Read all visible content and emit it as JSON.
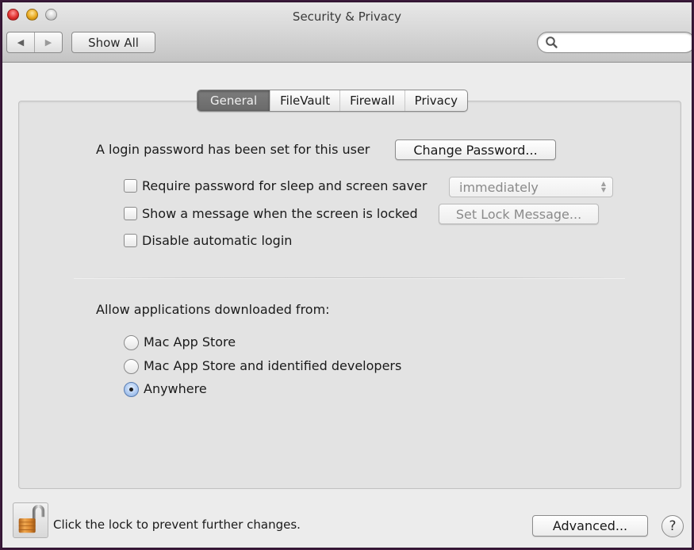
{
  "window": {
    "title": "Security & Privacy",
    "controls": [
      "close",
      "minimize",
      "zoom"
    ]
  },
  "toolbar": {
    "back_icon": "◀",
    "forward_icon": "▶",
    "show_all_label": "Show All",
    "search": {
      "value": "",
      "placeholder": ""
    }
  },
  "tabs": [
    {
      "label": "General",
      "active": true
    },
    {
      "label": "FileVault",
      "active": false
    },
    {
      "label": "Firewall",
      "active": false
    },
    {
      "label": "Privacy",
      "active": false
    }
  ],
  "general": {
    "login_password_text": "A login password has been set for this user",
    "change_password_label": "Change Password...",
    "require_password": {
      "label": "Require password for sleep and screen saver",
      "checked": false,
      "delay_value": "immediately",
      "delay_arrows": "▲\n▼"
    },
    "show_message": {
      "label": "Show a message when the screen is locked",
      "checked": false,
      "button_label": "Set Lock Message..."
    },
    "disable_auto_login": {
      "label": "Disable automatic login",
      "checked": false
    },
    "allow_apps_heading": "Allow applications downloaded from:",
    "allow_apps_options": [
      {
        "label": "Mac App Store",
        "selected": false
      },
      {
        "label": "Mac App Store and identified developers",
        "selected": false
      },
      {
        "label": "Anywhere",
        "selected": true
      }
    ]
  },
  "footer": {
    "lock_text": "Click the lock to prevent further changes.",
    "lock_state": "unlocked",
    "advanced_label": "Advanced...",
    "help_label": "?"
  }
}
